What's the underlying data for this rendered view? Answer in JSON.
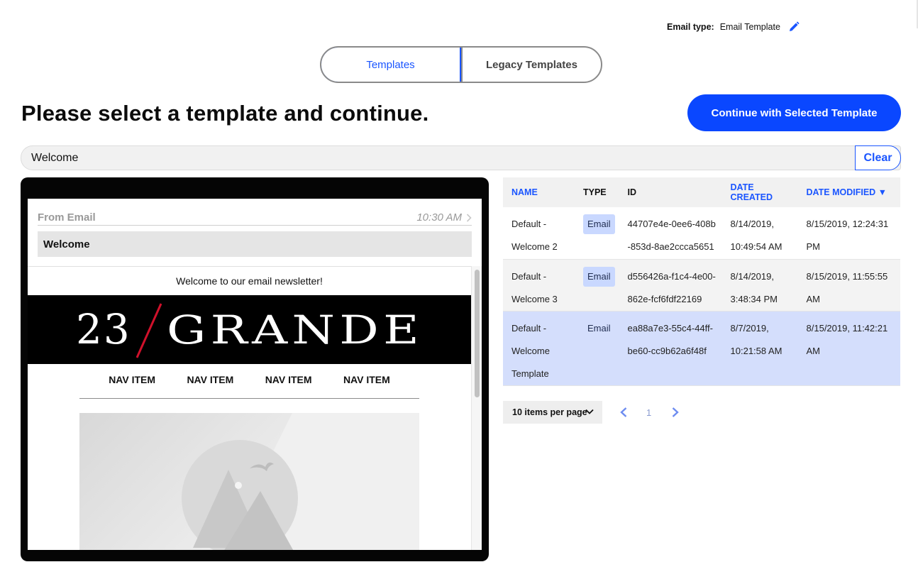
{
  "header": {
    "email_type_label": "Email type:",
    "email_type_value": "Email Template"
  },
  "tabs": [
    {
      "label": "Templates",
      "active": true
    },
    {
      "label": "Legacy Templates",
      "active": false
    }
  ],
  "page_title": "Please select a template and continue.",
  "continue_button": "Continue with Selected Template",
  "search": {
    "value": "Welcome",
    "clear_label": "Clear"
  },
  "preview": {
    "from": "From Email",
    "time": "10:30 AM",
    "subject": "Welcome",
    "newsletter_text": "Welcome to our email newsletter!",
    "logo": "23/GRANDE",
    "logo_left": "23",
    "logo_right": "GRANDE",
    "nav_items": [
      "NAV ITEM",
      "NAV ITEM",
      "NAV ITEM",
      "NAV ITEM"
    ]
  },
  "table": {
    "columns": [
      "NAME",
      "TYPE",
      "ID",
      "DATE CREATED",
      "DATE MODIFIED ▼"
    ],
    "rows": [
      {
        "name": "Default - Welcome 2",
        "type": "Email",
        "id": "44707e4e-0ee6-408b-853d-8ae2ccca5651",
        "created": "8/14/2019, 10:49:54 AM",
        "modified": "8/15/2019, 12:24:31 PM"
      },
      {
        "name": "Default - Welcome 3",
        "type": "Email",
        "id": "d556426a-f1c4-4e00-862e-fcf6fdf22169",
        "created": "8/14/2019, 3:48:34 PM",
        "modified": "8/15/2019, 11:55:55 AM"
      },
      {
        "name": "Default - Welcome Template",
        "type": "Email",
        "id": "ea88a7e3-55c4-44ff-be60-cc9b62a6f48f",
        "created": "8/7/2019, 10:21:58 AM",
        "modified": "8/15/2019, 11:42:21 AM",
        "selected": true
      }
    ]
  },
  "pagination": {
    "per_page_label": "10 items per page",
    "current_page": "1"
  },
  "colors": {
    "accent": "#0a47ff",
    "selected_row": "#d4defc",
    "badge": "#c9d8ff"
  },
  "icons": [
    "pencil-icon",
    "chevron-right-icon",
    "chevron-down-icon",
    "chevron-left-icon",
    "image-placeholder-icon"
  ]
}
